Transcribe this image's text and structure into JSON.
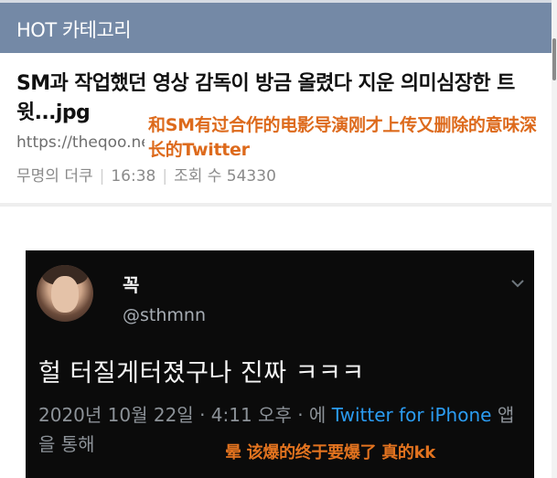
{
  "header": {
    "title": "HOT 카테고리"
  },
  "article": {
    "title": "SM과 작업했던 영상 감독이 방금 올렸다 지운 의미심장한 트윗...jpg",
    "url": "https://theqoo.net",
    "meta": {
      "author": "무명의 더쿠",
      "time": "16:38",
      "views": "조회 수 54330"
    }
  },
  "overlay": {
    "top_caption": "和SM有过合作的电影导演刚才上传又删除的意味深长的Twitter",
    "bottom_caption": "晕 该爆的终于要爆了 真的kk"
  },
  "tweet": {
    "name": "꼭",
    "handle": "@sthmnn",
    "text": "헐 터질게터졌구나 진짜 ㅋㅋㅋ",
    "date": "2020년 10월 22일 · 4:11 오후 · 에",
    "via_link": "Twitter for iPhone",
    "via_suffix": "앱을 통해"
  },
  "colors": {
    "header_bg": "#7489a6",
    "overlay_text": "#dd6a1c",
    "tweet_bg": "#0b0b0b",
    "tweet_link": "#2b9cf2"
  },
  "icons": {
    "tweet_menu": "chevron-down-icon",
    "avatar": "avatar"
  }
}
